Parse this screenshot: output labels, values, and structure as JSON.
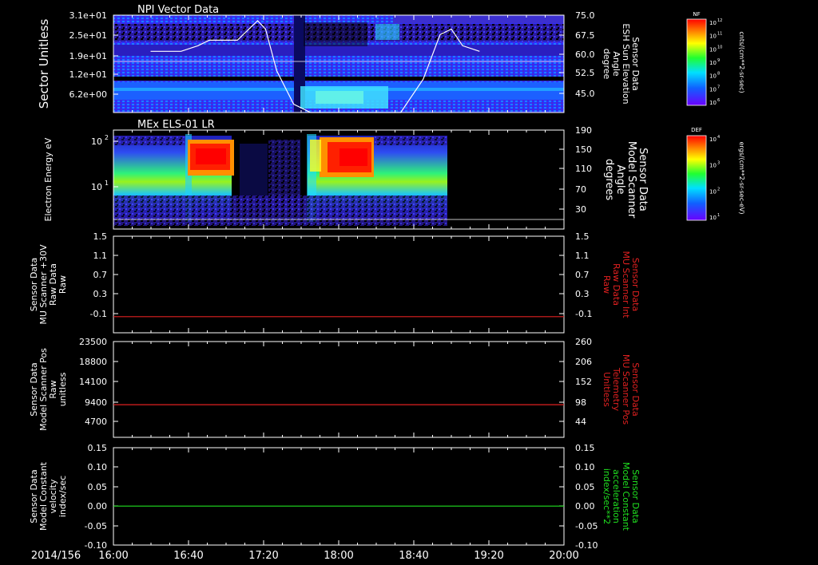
{
  "x_axis": {
    "date": "2014/156",
    "ticks": [
      "16:00",
      "16:40",
      "17:20",
      "18:00",
      "18:40",
      "19:20",
      "20:00"
    ]
  },
  "colorbars": [
    {
      "label": "NF",
      "unit": "cnts/(cm**2-sr-sec)",
      "ticks": [
        "10^12",
        "10^11",
        "10^10",
        "10^9",
        "10^8",
        "10^7",
        "10^6"
      ]
    },
    {
      "label": "DEF",
      "unit": "ergs/(cm**2-sr-sec-eV)",
      "ticks": [
        "10^4",
        "10^3",
        "10^2",
        "10^1"
      ]
    }
  ],
  "chart_data": [
    {
      "type": "heatmap",
      "title": "NPI Vector Data",
      "ylabel": "Sector Unitless",
      "ytick_labels": [
        "3.1e+01",
        "2.5e+01",
        "1.9e+01",
        "1.2e+01",
        "6.2e+00"
      ],
      "right_ylabel": [
        "Sensor Data",
        "ESH Sun Elevation",
        "Angle",
        "degree"
      ],
      "right_ytick_labels": [
        "75.0",
        "67.5",
        "60.0",
        "52.5",
        "45.0"
      ],
      "right_ylim": [
        40,
        75
      ],
      "overlay_series": {
        "name": "ESH Sun Elevation Angle",
        "color": "#ffffff",
        "x": [
          16.33,
          16.6,
          16.75,
          16.85,
          17.1,
          17.28,
          17.35,
          17.45,
          17.6,
          17.75,
          17.9,
          18.2,
          18.55,
          18.75,
          18.9,
          19.0,
          19.1,
          19.25
        ],
        "y": [
          62,
          62,
          64,
          66,
          66,
          73,
          70,
          55,
          43,
          40,
          40,
          40,
          40,
          52,
          68,
          70,
          64,
          62
        ]
      }
    },
    {
      "type": "heatmap",
      "title": "MEx ELS-01 LR",
      "ylabel": "Electron Energy eV",
      "ytick_labels": [
        "10^2",
        "10^1"
      ],
      "right_ylabel": [
        "Sensor Data",
        "Model Scanner",
        "Angle",
        "degrees"
      ],
      "right_ytick_labels": [
        "190",
        "150",
        "110",
        "70",
        "30"
      ],
      "right_ylim": [
        10,
        190
      ]
    },
    {
      "type": "line",
      "ylabel": [
        "Sensor Data",
        "MU Scanner +30V",
        "Raw Data",
        "Raw"
      ],
      "ytick_labels": [
        "1.5",
        "1.1",
        "0.7",
        "0.3",
        "-0.1"
      ],
      "ylim": [
        -0.3,
        1.5
      ],
      "right_ylabel": [
        "Sensor Data",
        "MU Scanner Int",
        "Raw Data",
        "Raw"
      ],
      "right_ytick_labels": [
        "1.5",
        "1.1",
        "0.7",
        "0.3",
        "-0.1"
      ],
      "series": [
        {
          "color": "#e02020",
          "x": [
            16.0,
            20.0
          ],
          "y": [
            0.0,
            0.0
          ]
        }
      ]
    },
    {
      "type": "line",
      "ylabel": [
        "Sensor Data",
        "Model Scanner Pos",
        "Raw",
        "unitless"
      ],
      "ytick_labels": [
        "23500",
        "18800",
        "14100",
        "9400",
        "4700"
      ],
      "ylim": [
        0,
        23500
      ],
      "right_ylabel": [
        "Sensor Data",
        "MU Scanner Pos",
        "Telemetry",
        "Unitless"
      ],
      "right_ytick_labels": [
        "260",
        "206",
        "152",
        "98",
        "44"
      ],
      "series": [
        {
          "color": "#e02020",
          "x": [
            16.0,
            20.0
          ],
          "y": [
            8000,
            8000
          ]
        }
      ]
    },
    {
      "type": "line",
      "ylabel": [
        "Sensor Data",
        "Model Constant",
        "velocity",
        "index/sec"
      ],
      "ytick_labels": [
        "0.15",
        "0.10",
        "0.05",
        "0.00",
        "-0.05",
        "-0.10"
      ],
      "ylim": [
        -0.1,
        0.15
      ],
      "right_ylabel": [
        "Sensor Data",
        "Model Constant",
        "acceleration",
        "index/sec**2"
      ],
      "right_ytick_labels": [
        "0.15",
        "0.10",
        "0.05",
        "0.00",
        "-0.05",
        "-0.10"
      ],
      "series": [
        {
          "color": "#20e020",
          "x": [
            16.0,
            20.0
          ],
          "y": [
            0.0,
            0.0
          ]
        }
      ]
    }
  ]
}
